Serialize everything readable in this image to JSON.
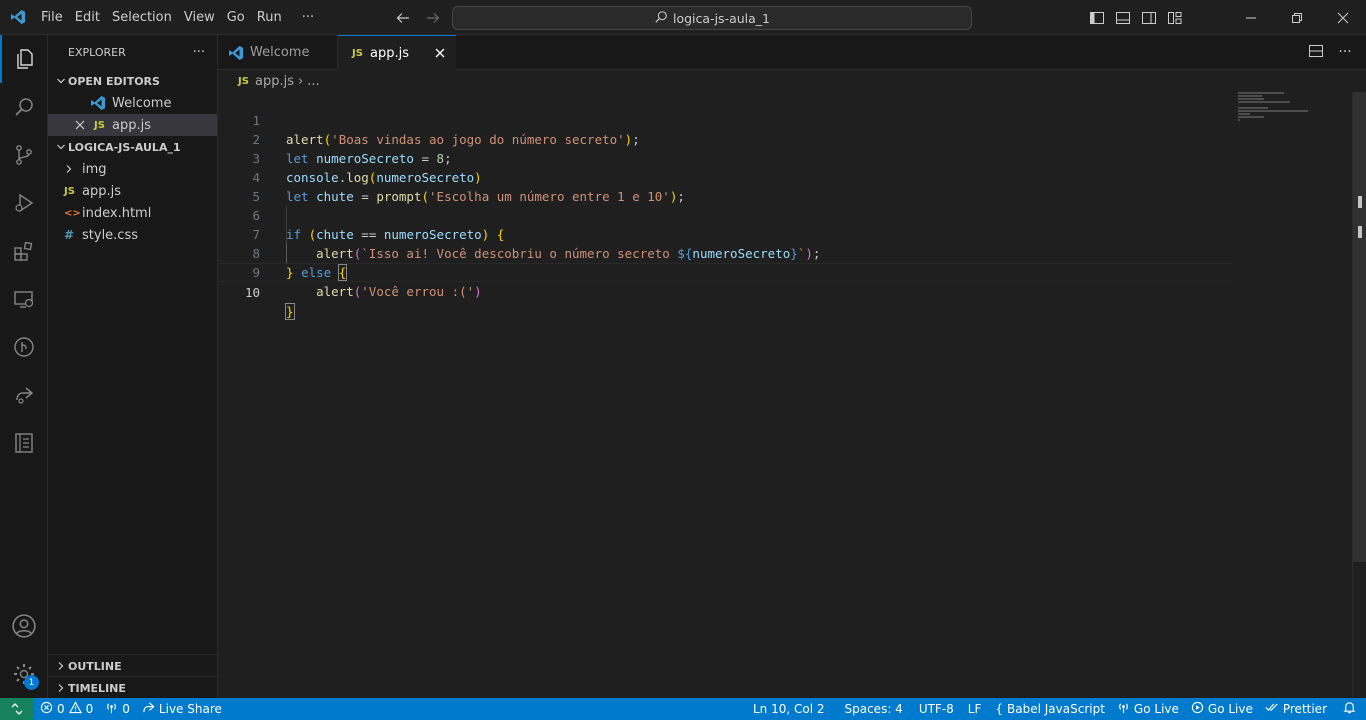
{
  "titlebar": {
    "menu": [
      "File",
      "Edit",
      "Selection",
      "View",
      "Go",
      "Run",
      "···"
    ],
    "search": "logica-js-aula_1"
  },
  "tabs": [
    {
      "label": "Welcome"
    },
    {
      "label": "app.js",
      "icon": "JS"
    }
  ],
  "breadcrumb": {
    "icon": "JS",
    "file": "app.js",
    "sep": "›",
    "rest": "..."
  },
  "sidebar": {
    "title": "EXPLORER",
    "more": "···",
    "open_editors": {
      "label": "OPEN EDITORS",
      "items": [
        {
          "label": "Welcome"
        },
        {
          "label": "app.js",
          "icon": "JS"
        }
      ]
    },
    "project": {
      "label": "LOGICA-JS-AULA_1",
      "items": [
        {
          "label": "img",
          "type": "folder"
        },
        {
          "label": "app.js",
          "icon": "JS"
        },
        {
          "label": "index.html",
          "icon": "<>"
        },
        {
          "label": "style.css",
          "icon": "#"
        }
      ]
    },
    "outline": "OUTLINE",
    "timeline": "TIMELINE"
  },
  "activity_badge": "1",
  "editor": {
    "line_numbers": [
      "1",
      "2",
      "3",
      "4",
      "5",
      "6",
      "7",
      "8",
      "9",
      "10"
    ],
    "current_line": 10
  },
  "statusbar": {
    "errors": "0",
    "warnings": "0",
    "ports": "0",
    "live_share": "Live Share",
    "position": "Ln 10, Col 2",
    "spaces": "Spaces: 4",
    "encoding": "UTF-8",
    "eol": "LF",
    "language": "Babel JavaScript",
    "go_live_1": "Go Live",
    "go_live_2": "Go Live",
    "prettier": "Prettier"
  },
  "colors": {
    "accent": "#0078d4",
    "statusbar": "#007acc",
    "remote": "#16825d",
    "js_icon": "#cbcb41",
    "html_icon": "#e37933",
    "css_icon": "#519aba",
    "vscode_icon": "#3c99d4"
  }
}
